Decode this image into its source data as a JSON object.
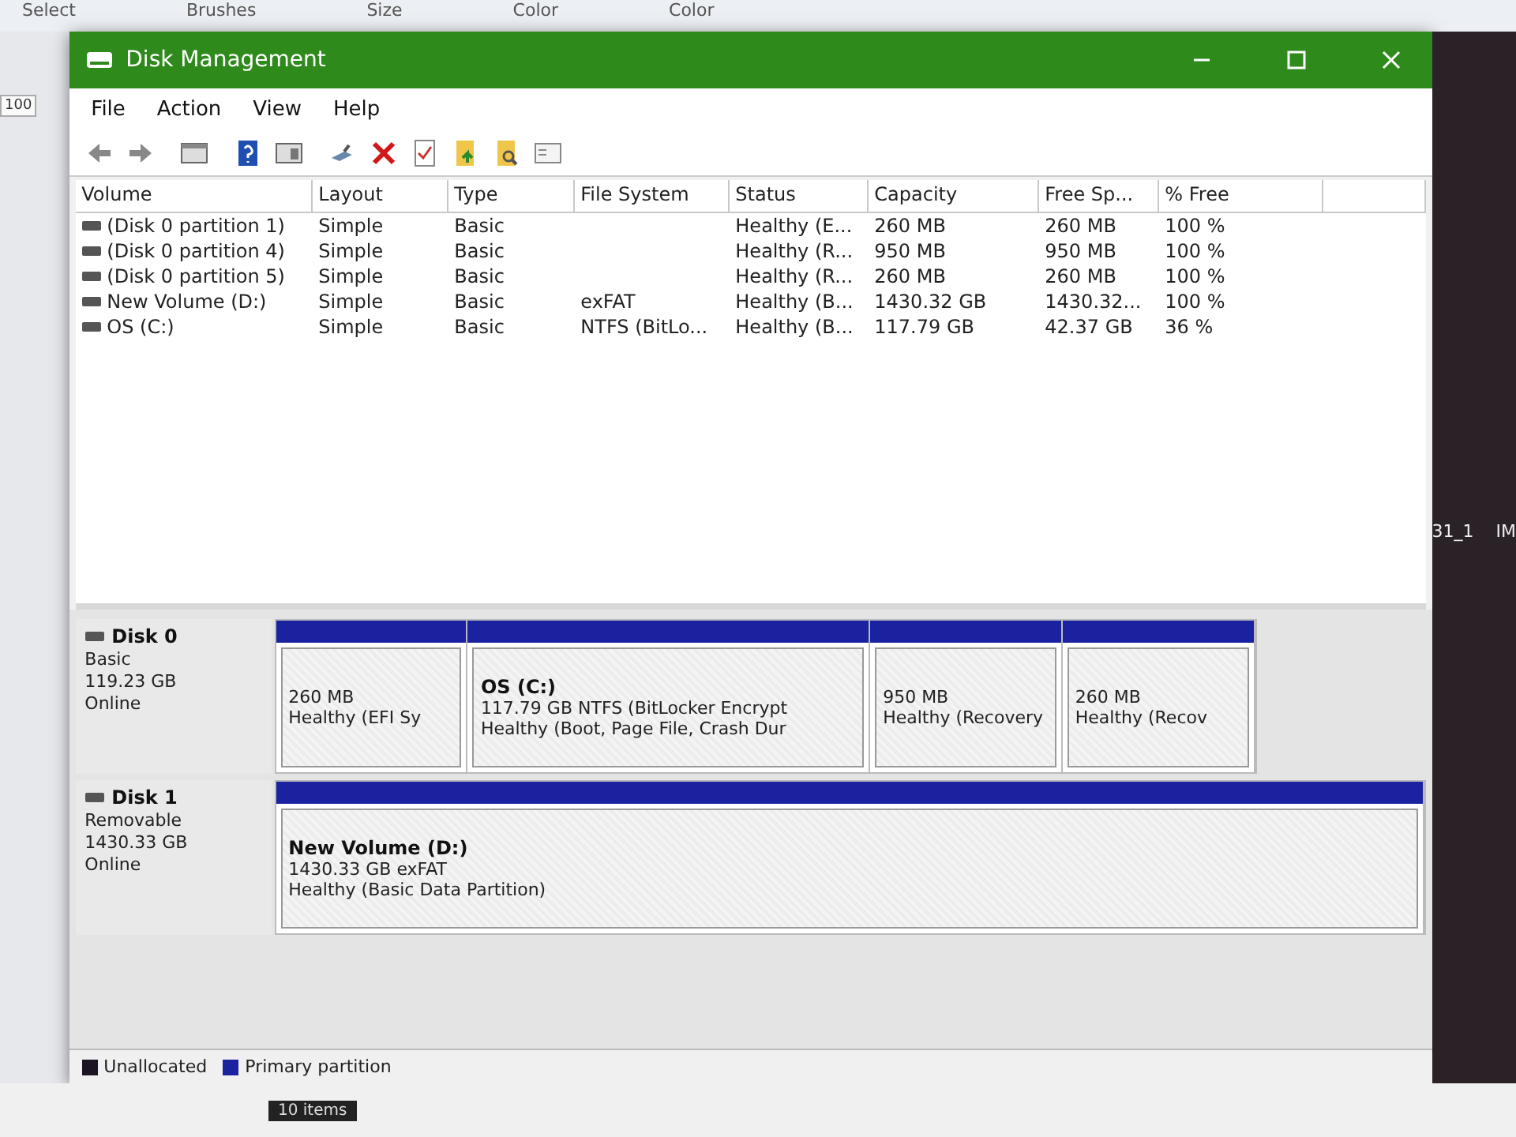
{
  "background": {
    "ribbon_labels": [
      "Select",
      "Brushes",
      "Size",
      "Color",
      "Color"
    ],
    "zoom_label": "100",
    "file_labels": [
      "31_1",
      "IM"
    ],
    "status_text": "10 items"
  },
  "window": {
    "title": "Disk Management"
  },
  "menu": [
    "File",
    "Action",
    "View",
    "Help"
  ],
  "toolbar": [
    {
      "kind": "back"
    },
    {
      "kind": "forward"
    },
    {
      "kind": "pane"
    },
    {
      "kind": "help"
    },
    {
      "kind": "pane2"
    },
    {
      "kind": "connect"
    },
    {
      "kind": "delete"
    },
    {
      "kind": "check"
    },
    {
      "kind": "folder"
    },
    {
      "kind": "search"
    },
    {
      "kind": "window"
    }
  ],
  "volume_table": {
    "columns": [
      "Volume",
      "Layout",
      "Type",
      "File System",
      "Status",
      "Capacity",
      "Free Sp...",
      "% Free"
    ],
    "rows": [
      {
        "cells": [
          "(Disk 0 partition 1)",
          "Simple",
          "Basic",
          "",
          "Healthy (E...",
          "260 MB",
          "260 MB",
          "100 %"
        ]
      },
      {
        "cells": [
          "(Disk 0 partition 4)",
          "Simple",
          "Basic",
          "",
          "Healthy (R...",
          "950 MB",
          "950 MB",
          "100 %"
        ]
      },
      {
        "cells": [
          "(Disk 0 partition 5)",
          "Simple",
          "Basic",
          "",
          "Healthy (R...",
          "260 MB",
          "260 MB",
          "100 %"
        ]
      },
      {
        "cells": [
          "New Volume (D:)",
          "Simple",
          "Basic",
          "exFAT",
          "Healthy (B...",
          "1430.32 GB",
          "1430.32...",
          "100 %"
        ]
      },
      {
        "cells": [
          "OS (C:)",
          "Simple",
          "Basic",
          "NTFS (BitLo...",
          "Healthy (B...",
          "117.79 GB",
          "42.37 GB",
          "36 %"
        ]
      }
    ]
  },
  "disks": [
    {
      "name": "Disk 0",
      "type": "Basic",
      "size": "119.23 GB",
      "status": "Online",
      "partitions": [
        {
          "lines": [
            "260 MB",
            "Healthy (EFI Sy"
          ]
        },
        {
          "name": "OS  (C:)",
          "lines": [
            "117.79 GB NTFS (BitLocker Encrypt",
            "Healthy (Boot, Page File, Crash Dur"
          ]
        },
        {
          "lines": [
            "950 MB",
            "Healthy (Recovery"
          ]
        },
        {
          "lines": [
            "260 MB",
            "Healthy (Recov"
          ]
        }
      ]
    },
    {
      "name": "Disk 1",
      "type": "Removable",
      "size": "1430.33 GB",
      "status": "Online",
      "partitions": [
        {
          "name": "New Volume  (D:)",
          "lines": [
            "1430.33 GB exFAT",
            "Healthy (Basic Data Partition)"
          ]
        }
      ]
    }
  ],
  "legend": [
    {
      "label": "Unallocated",
      "color": "#1c1424"
    },
    {
      "label": "Primary partition",
      "color": "#1b22a0"
    }
  ]
}
